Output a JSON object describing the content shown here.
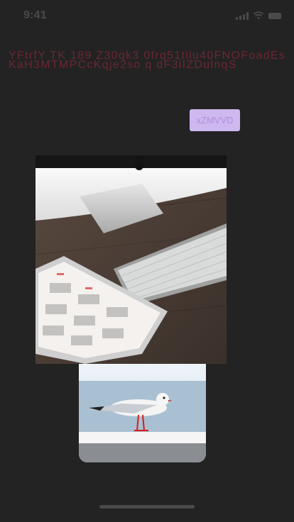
{
  "status_bar": {
    "time": "9:41",
    "icons": [
      "signal-icon",
      "wifi-icon",
      "battery-icon"
    ]
  },
  "content": {
    "title": "YFtrfY TK 189 Z30qk3 0frq51tllu40FNOFoadEsKaH3MTMPCcKqje2so q dF3iIZDulnqS",
    "button_label": "xZMVVD"
  },
  "images": [
    {
      "name": "desk-photo",
      "subject": "iMac base, keyboard and tablet showing calendar on wooden desk"
    },
    {
      "name": "seagull-photo",
      "subject": "seagull standing on white railing by the sea"
    }
  ],
  "colors": {
    "background": "#232323",
    "title_text": "#6a2734",
    "button_bg": "#cdb8ef",
    "button_text": "#b28fe0",
    "status": "#4a4a4a"
  }
}
